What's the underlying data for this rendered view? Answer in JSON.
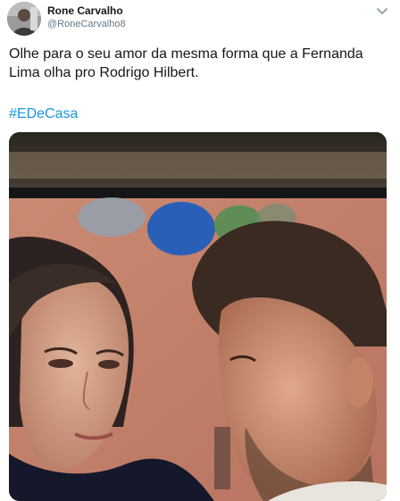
{
  "tweet": {
    "display_name": "Rone Carvalho",
    "handle": "@RoneCarvalho8",
    "text": "Olhe para o seu amor da mesma forma que a Fernanda Lima olha pro Rodrigo Hilbert.",
    "hashtag": "#EDeCasa",
    "avatar_icon": "user-avatar",
    "menu_icon": "chevron-down-icon",
    "media_icon": "tv-screen-photo"
  },
  "colors": {
    "text": "#14171a",
    "secondary_text": "#657786",
    "link": "#1b95e0",
    "background": "#ffffff"
  }
}
